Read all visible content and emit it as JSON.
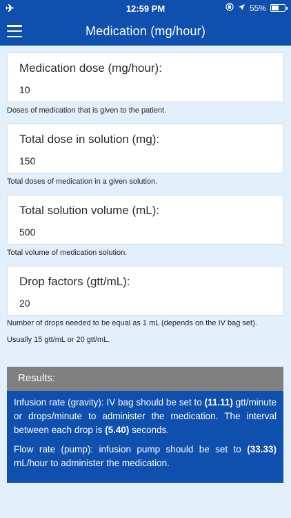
{
  "status_bar": {
    "airplane": "✈",
    "time": "12:59 PM",
    "battery_percent": "55%",
    "battery_level": 0.55
  },
  "header": {
    "title": "Medication (mg/hour)"
  },
  "fields": [
    {
      "label": "Medication dose (mg/hour):",
      "value": "10",
      "help": "Doses of medication that is given to the patient."
    },
    {
      "label": "Total dose in solution (mg):",
      "value": "150",
      "help": "Total doses of medication in a given solution."
    },
    {
      "label": "Total solution volume (mL):",
      "value": "500",
      "help": "Total volume of medication solution."
    },
    {
      "label": "Drop factors (gtt/mL):",
      "value": "20",
      "help_line1": "Number of drops needed to be equal as 1 mL (depends on the IV bag set).",
      "help_line2": "Usually 15 gtt/mL or 20 gtt/mL."
    }
  ],
  "results": {
    "title": "Results:",
    "gravity_text_1": "Infusion rate (gravity): IV bag should be set to ",
    "gravity_value": "(11.11)",
    "gravity_text_2": " gtt/minute or drops/minute to administer the medication. The interval between each drop is ",
    "interval_value": "(5.40)",
    "gravity_text_3": " seconds.",
    "pump_text_1": "Flow rate (pump): infusion pump should be set to ",
    "pump_value": "(33.33)",
    "pump_text_2": " mL/hour to administer the medication."
  }
}
